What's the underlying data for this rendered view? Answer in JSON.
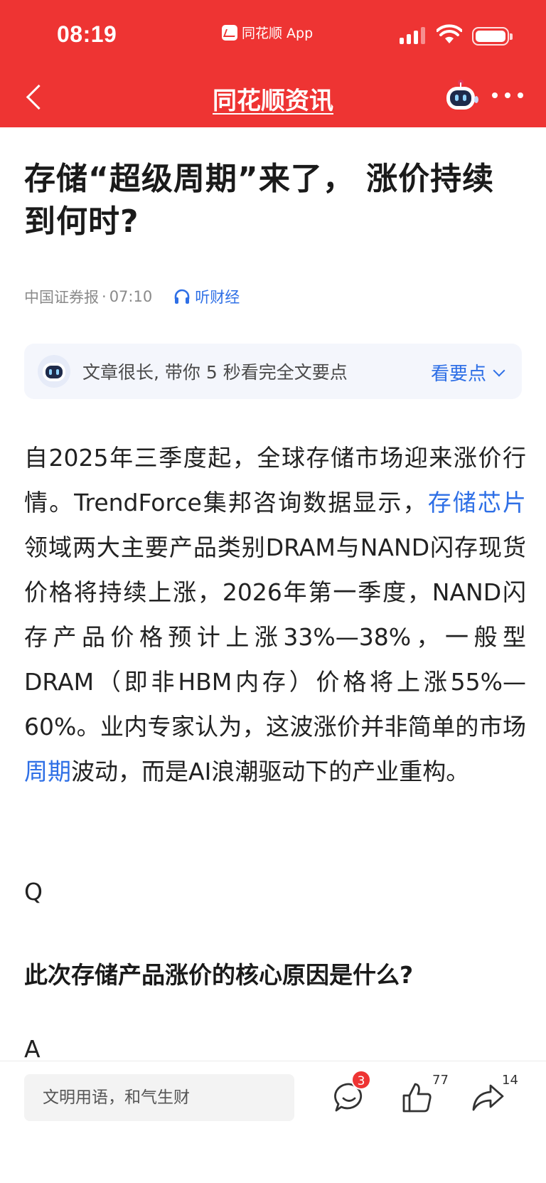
{
  "status_bar": {
    "time": "08:19",
    "app_label": "同花顺 App",
    "icons": [
      "signal-icon",
      "wifi-icon",
      "battery-icon"
    ]
  },
  "nav": {
    "title": "同花顺资讯",
    "icons": [
      "back-arrow-icon",
      "robot-assistant-icon",
      "more-icon"
    ]
  },
  "article": {
    "title": "存储“超级周期”来了， 涨价持续到何时?",
    "source": "中国证券报",
    "separator": "·",
    "time": "07:10",
    "listen_label": "听财经",
    "summary_prompt": "文章很长, 带你 5 秒看完全文要点",
    "summary_link": "看要点",
    "paragraph": {
      "p1": "自2025年三季度起，全球存储市场迎来涨价行情。TrendForce集邦咨询数据显示，",
      "link1": "存储芯片",
      "p2": "领域两大主要产品类别DRAM与NAND闪存现货价格将持续上涨，2026年第一季度，NAND闪存产品价格预计上涨33%—38%，一般型DRAM（即非HBM内存）价格将上涨55%—60%。业内专家认为，这波涨价并非简单的市场",
      "link2": "周期",
      "p3": "波动，而是AI浪潮驱动下的产业重构。"
    },
    "q_marker": "Q",
    "question": "此次存储产品涨价的核心原因是什么?",
    "a_marker": "A"
  },
  "bottom_bar": {
    "comment_placeholder": "文明用语，和气生财",
    "comment_badge": "3",
    "like_count": "77",
    "share_count": "14"
  },
  "colors": {
    "brand_red": "#ee3433",
    "link_blue": "#2e6fe6"
  }
}
